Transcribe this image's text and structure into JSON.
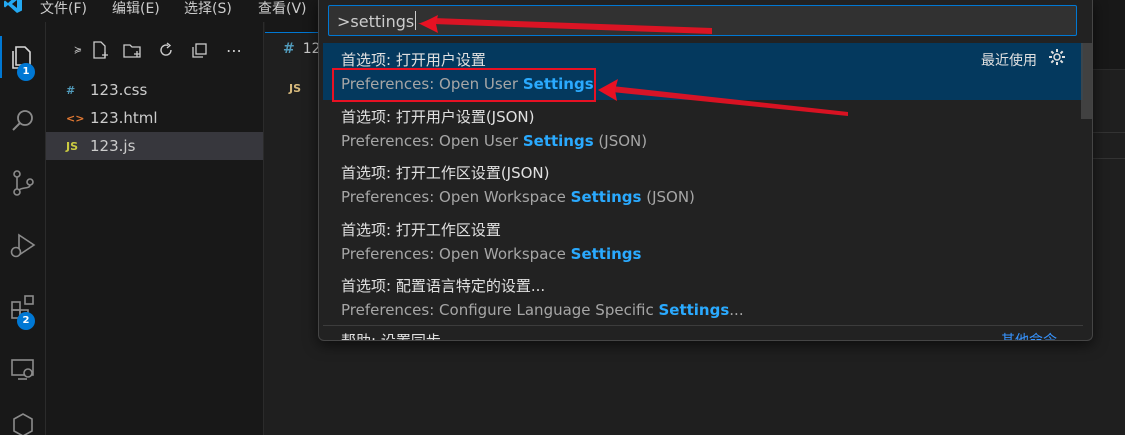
{
  "menubar": {
    "items": [
      "文件(F)",
      "编辑(E)",
      "选择(S)",
      "查看(V)"
    ]
  },
  "activitybar": {
    "explorer_badge": "1",
    "extensions_badge": "2"
  },
  "explorer": {
    "files": [
      {
        "name": "123.css",
        "icon": "#",
        "icon_color": "#519aba"
      },
      {
        "name": "123.html",
        "icon": "<>",
        "icon_color": "#e37933"
      },
      {
        "name": "123.js",
        "icon": "JS",
        "icon_color": "#cbcb41"
      }
    ]
  },
  "editor": {
    "tab_icon": "#",
    "tab_label": "12",
    "breadcrumb_icon": "JS"
  },
  "quick_pick": {
    "input_value": ">settings",
    "recently_used": "最近使用",
    "items": [
      {
        "label": "首选项: 打开用户设置",
        "detail_prefix": "Preferences: Open User ",
        "detail_match": "Settings",
        "detail_suffix": ""
      },
      {
        "label": "首选项: 打开用户设置(JSON)",
        "detail_prefix": "Preferences: Open User ",
        "detail_match": "Settings",
        "detail_suffix": " (JSON)"
      },
      {
        "label": "首选项: 打开工作区设置(JSON)",
        "detail_prefix": "Preferences: Open Workspace ",
        "detail_match": "Settings",
        "detail_suffix": " (JSON)"
      },
      {
        "label": "首选项: 打开工作区设置",
        "detail_prefix": "Preferences: Open Workspace ",
        "detail_match": "Settings",
        "detail_suffix": ""
      },
      {
        "label": "首选项: 配置语言特定的设置...",
        "detail_prefix": "Preferences: Configure Language Specific ",
        "detail_match": "Settings",
        "detail_suffix": "..."
      }
    ],
    "last_item_label": "帮助: 设置同步",
    "other_commands": "其他命令"
  },
  "colors": {
    "accent": "#0078d4",
    "highlight": "#2aaaff",
    "annotation": "#e81123"
  }
}
